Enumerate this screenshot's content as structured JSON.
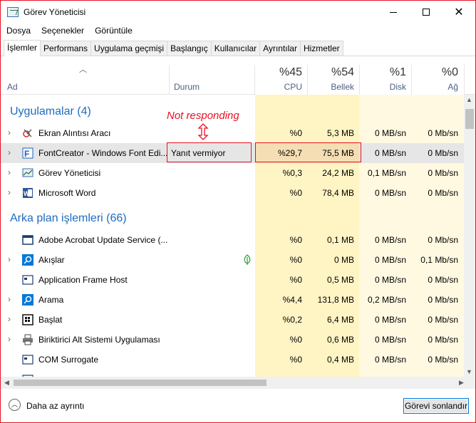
{
  "window": {
    "title": "Görev Yöneticisi"
  },
  "menu": [
    "Dosya",
    "Seçenekler",
    "Görüntüle"
  ],
  "tabs": [
    "İşlemler",
    "Performans",
    "Uygulama geçmişi",
    "Başlangıç",
    "Kullanıcılar",
    "Ayrıntılar",
    "Hizmetler"
  ],
  "active_tab": "İşlemler",
  "columns": {
    "name": "Ad",
    "status": "Durum",
    "cpu": {
      "pct": "%45",
      "label": "CPU"
    },
    "mem": {
      "pct": "%54",
      "label": "Bellek"
    },
    "disk": {
      "pct": "%1",
      "label": "Disk"
    },
    "net": {
      "pct": "%0",
      "label": "Ağ"
    }
  },
  "annotation": {
    "text": "Not responding",
    "color": "#e81123"
  },
  "groups": {
    "apps": "Uygulamalar (4)",
    "background": "Arka plan işlemleri (66)"
  },
  "apps": [
    {
      "name": "Ekran Alıntısı Aracı",
      "status": "",
      "cpu": "%0",
      "mem": "5,3 MB",
      "disk": "0 MB/sn",
      "net": "0 Mb/sn",
      "icon": "snipping-tool-icon"
    },
    {
      "name": "FontCreator - Windows Font Edi...",
      "status": "Yanıt vermiyor",
      "cpu": "%29,7",
      "mem": "75,5 MB",
      "disk": "0 MB/sn",
      "net": "0 Mb/sn",
      "icon": "fontcreator-icon"
    },
    {
      "name": "Görev Yöneticisi",
      "status": "",
      "cpu": "%0,3",
      "mem": "24,2 MB",
      "disk": "0,1 MB/sn",
      "net": "0 Mb/sn",
      "icon": "task-manager-icon"
    },
    {
      "name": "Microsoft Word",
      "status": "",
      "cpu": "%0",
      "mem": "78,4 MB",
      "disk": "0 MB/sn",
      "net": "0 Mb/sn",
      "icon": "word-icon"
    }
  ],
  "background": [
    {
      "name": "Adobe Acrobat Update Service (...",
      "cpu": "%0",
      "mem": "0,1 MB",
      "disk": "0 MB/sn",
      "net": "0 Mb/sn",
      "icon": "service-window-icon",
      "chevron": false
    },
    {
      "name": "Akışlar",
      "cpu": "%0",
      "mem": "0 MB",
      "disk": "0 MB/sn",
      "net": "0,1 Mb/sn",
      "icon": "search-blue-icon",
      "chevron": true,
      "leaf": true
    },
    {
      "name": "Application Frame Host",
      "cpu": "%0",
      "mem": "0,5 MB",
      "disk": "0 MB/sn",
      "net": "0 Mb/sn",
      "icon": "app-frame-icon",
      "chevron": false
    },
    {
      "name": "Arama",
      "cpu": "%4,4",
      "mem": "131,8 MB",
      "disk": "0,2 MB/sn",
      "net": "0 Mb/sn",
      "icon": "search-blue-icon",
      "chevron": true
    },
    {
      "name": "Başlat",
      "cpu": "%0,2",
      "mem": "6,4 MB",
      "disk": "0 MB/sn",
      "net": "0 Mb/sn",
      "icon": "start-icon",
      "chevron": true
    },
    {
      "name": "Biriktirici Alt Sistemi Uygulaması",
      "cpu": "%0",
      "mem": "0,6 MB",
      "disk": "0 MB/sn",
      "net": "0 Mb/sn",
      "icon": "printer-icon",
      "chevron": true
    },
    {
      "name": "COM Surrogate",
      "cpu": "%0",
      "mem": "0,4 MB",
      "disk": "0 MB/sn",
      "net": "0 Mb/sn",
      "icon": "app-frame-icon",
      "chevron": false
    }
  ],
  "footer": {
    "less_details": "Daha az ayrıntı",
    "end_task": "Görevi sonlandır"
  },
  "colors": {
    "accent": "#0078d7",
    "heat_light": "#fff9e1",
    "heat_mid": "#fff4c4",
    "heat_hot": "#f5deb3",
    "group_text": "#1e6bbf",
    "annotation": "#e81123"
  }
}
